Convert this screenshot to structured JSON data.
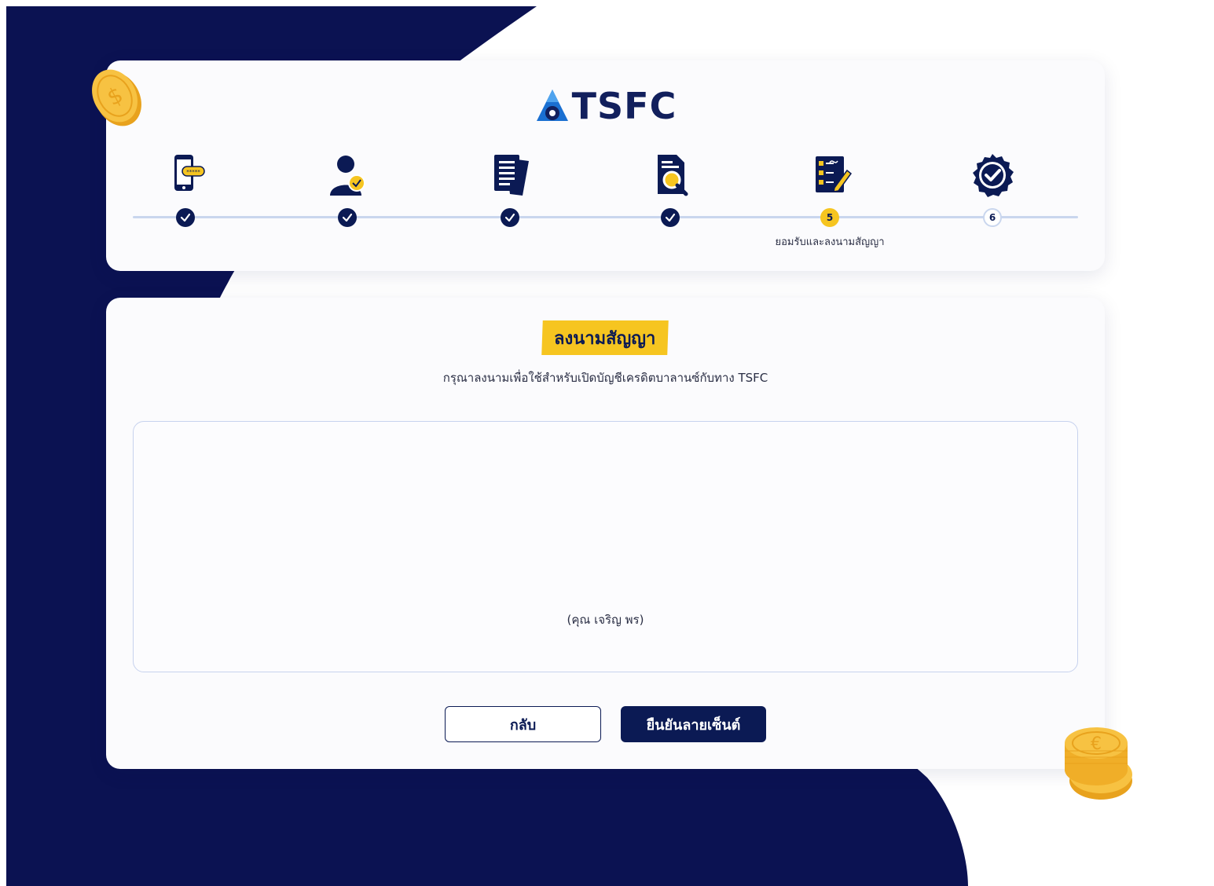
{
  "brand": {
    "logo_text": "TSFC"
  },
  "stepper": {
    "steps": [
      {
        "icon": "phone-otp-icon",
        "status": "done",
        "label": ""
      },
      {
        "icon": "person-verify-icon",
        "status": "done",
        "label": ""
      },
      {
        "icon": "documents-icon",
        "status": "done",
        "label": ""
      },
      {
        "icon": "document-search-icon",
        "status": "done",
        "label": ""
      },
      {
        "icon": "checklist-sign-icon",
        "status": "active",
        "number": "5",
        "label": "ยอมรับและลงนามสัญญา"
      },
      {
        "icon": "verified-badge-icon",
        "status": "pending",
        "number": "6",
        "label": ""
      }
    ]
  },
  "main": {
    "title": "ลงนามสัญญา",
    "subtitle": "กรุณาลงนามเพื่อใช้สำหรับเปิดบัญชีเครดิตบาลานซ์กับทาง TSFC",
    "signer_name": "(คุณ เจริญ พร)",
    "back_label": "กลับ",
    "confirm_label": "ยืนยันลายเซ็นต์"
  },
  "colors": {
    "navy": "#0b1a54",
    "accent": "#f6c520",
    "line": "#c9d6ee"
  }
}
